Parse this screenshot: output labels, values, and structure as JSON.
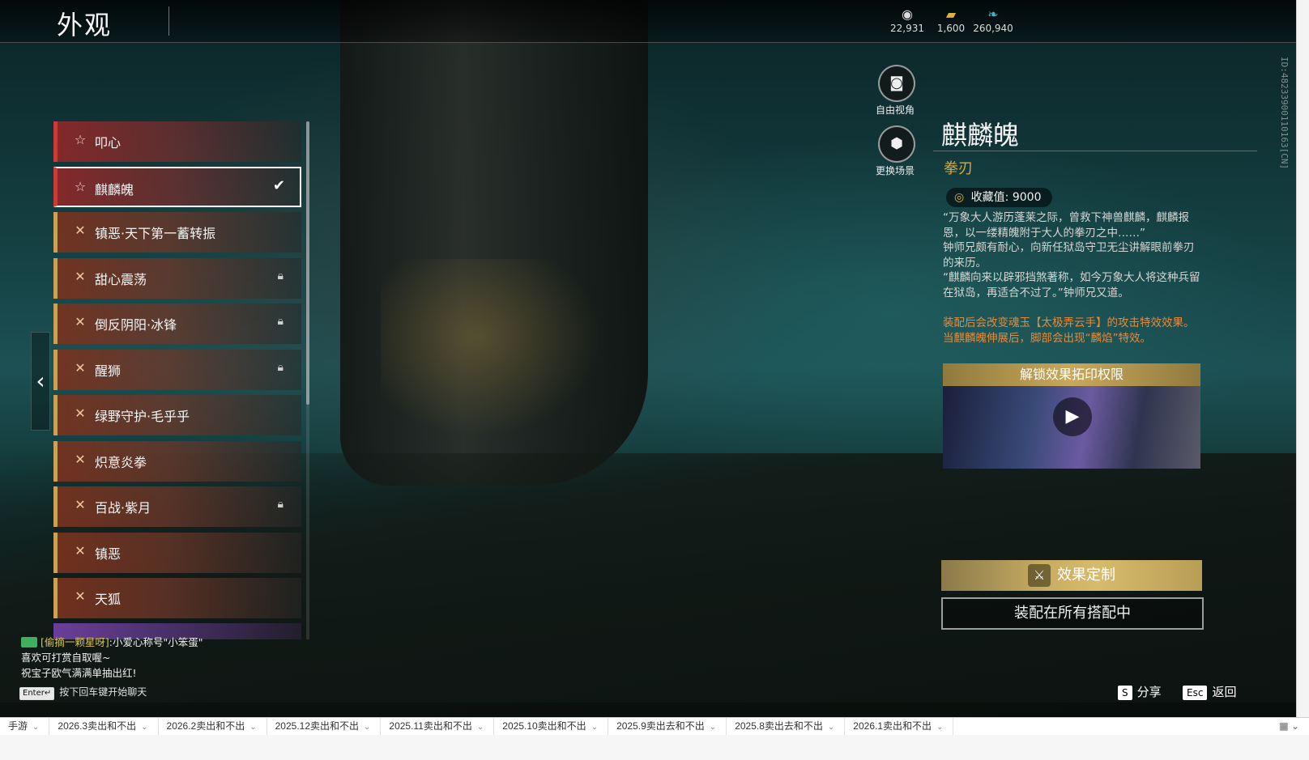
{
  "header": {
    "title": "外观",
    "currencies": [
      {
        "icon": "spiral-coin-icon",
        "value": "22,931"
      },
      {
        "icon": "gold-bar-icon",
        "value": "1,600"
      },
      {
        "icon": "jade-feather-icon",
        "value": "260,940"
      }
    ],
    "vertical_id": "ID:4823390011016​3[CN]"
  },
  "list": {
    "items": [
      {
        "label": "叩心",
        "style": "red",
        "icon": "star-icon",
        "locked": false,
        "selected": false
      },
      {
        "label": "麒麟魄",
        "style": "red",
        "icon": "star-icon",
        "locked": false,
        "selected": true
      },
      {
        "label": "镇恶·天下第一蓄转振",
        "style": "gold",
        "icon": "cross-icon",
        "locked": false,
        "selected": false
      },
      {
        "label": "甜心震荡",
        "style": "gold",
        "icon": "cross-icon",
        "locked": true,
        "selected": false
      },
      {
        "label": "倒反阴阳·冰锋",
        "style": "gold",
        "icon": "cross-icon",
        "locked": true,
        "selected": false
      },
      {
        "label": "醒狮",
        "style": "gold",
        "icon": "cross-icon",
        "locked": true,
        "selected": false
      },
      {
        "label": "绿野守护·毛乎乎",
        "style": "gold",
        "icon": "cross-icon",
        "locked": false,
        "selected": false
      },
      {
        "label": "炽意炎拳",
        "style": "gold",
        "icon": "cross-icon",
        "locked": false,
        "selected": false
      },
      {
        "label": "百战·紫月",
        "style": "gold",
        "icon": "cross-icon",
        "locked": true,
        "selected": false
      },
      {
        "label": "镇恶",
        "style": "gold",
        "icon": "cross-icon",
        "locked": false,
        "selected": false
      },
      {
        "label": "天狐",
        "style": "gold",
        "icon": "cross-icon",
        "locked": false,
        "selected": false
      }
    ]
  },
  "camera": {
    "free_view_label": "自由视角",
    "change_scene_label": "更换场景"
  },
  "detail": {
    "name": "麒麟魄",
    "category": "拳刃",
    "collect_label": "收藏值:",
    "collect_value": "9000",
    "description": [
      "“万象大人游历蓬莱之际，曾救下神兽麒麟，麒麟报恩，以一缕精魄附于大人的拳刃之中……”",
      "钟师兄颇有耐心，向新任狱岛守卫无尘讲解眼前拳刃的来历。",
      "“麒麟向来以辟邪挡煞著称，如今万象大人将这种兵留在狱岛，再适合不过了。”钟师兄又道。"
    ],
    "effect": [
      "装配后会改变魂玉【太极弄云手】的攻击特效效果。",
      "当麒麟魄伸展后，脚部会出现“麟焰”特效。"
    ],
    "unlock_title": "解锁效果拓印权限",
    "custom_button": "效果定制",
    "equip_button": "装配在所有搭配中"
  },
  "chat": {
    "sender": "[偷摘一颗星呀]",
    "message": ":小爱心称号\"小笨蛋\"",
    "lines": [
      "喜欢可打赏自取喔~",
      "祝宝子欧气满满单抽出红!"
    ],
    "enter_key": "Enter↵",
    "hint": "按下回车键开始聊天"
  },
  "hotkeys": {
    "share_key": "S",
    "share_label": "分享",
    "back_key": "Esc",
    "back_label": "返回"
  },
  "sheet_tabs": [
    "手游",
    "2026.3卖出和不出",
    "2026.2卖出和不出",
    "2025.12卖出和不出",
    "2025.11卖出和不出",
    "2025.10卖出和不出",
    "2025.9卖出去和不出",
    "2025.8卖出去和不出",
    "2026.1卖出和不出"
  ]
}
